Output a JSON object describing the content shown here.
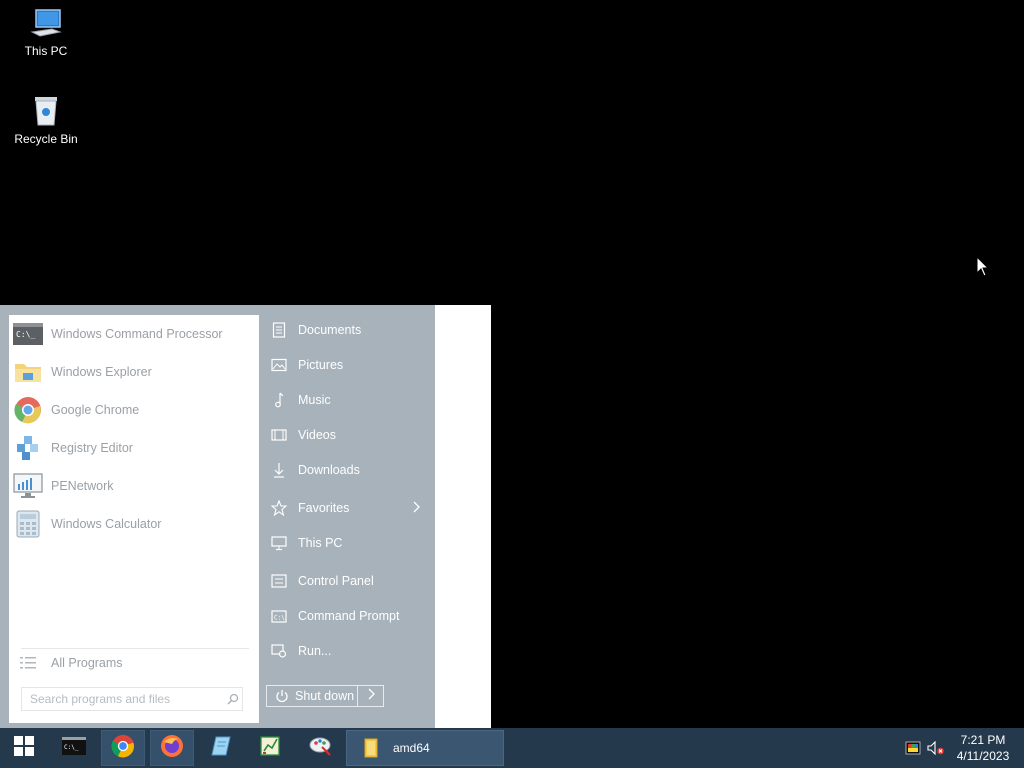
{
  "desktop": {
    "icons": [
      {
        "label": "This PC",
        "icon": "computer-icon"
      },
      {
        "label": "Recycle Bin",
        "icon": "recycle-bin-icon"
      }
    ]
  },
  "start_menu": {
    "programs": [
      {
        "label": "Windows Command Processor",
        "icon": "cmd-icon"
      },
      {
        "label": "Windows Explorer",
        "icon": "folder-icon"
      },
      {
        "label": "Google Chrome",
        "icon": "chrome-icon"
      },
      {
        "label": "Registry Editor",
        "icon": "registry-icon"
      },
      {
        "label": "PENetwork",
        "icon": "network-icon"
      },
      {
        "label": "Windows Calculator",
        "icon": "calculator-icon"
      }
    ],
    "all_programs_label": "All Programs",
    "search_placeholder": "Search programs and files",
    "right_items": [
      {
        "label": "Documents",
        "icon": "documents-icon"
      },
      {
        "label": "Pictures",
        "icon": "pictures-icon"
      },
      {
        "label": "Music",
        "icon": "music-icon"
      },
      {
        "label": "Videos",
        "icon": "videos-icon"
      },
      {
        "label": "Downloads",
        "icon": "downloads-icon"
      },
      {
        "label": "Favorites",
        "icon": "star-icon"
      },
      {
        "label": "This PC",
        "icon": "computer-icon"
      },
      {
        "label": "Control Panel",
        "icon": "control-panel-icon"
      },
      {
        "label": "Command Prompt",
        "icon": "cmd-icon"
      },
      {
        "label": "Run...",
        "icon": "run-icon"
      }
    ],
    "shutdown_label": "Shut down"
  },
  "taskbar": {
    "pinned": [
      {
        "icon": "cmd-icon"
      },
      {
        "icon": "chrome-icon"
      },
      {
        "icon": "firefox-icon"
      },
      {
        "icon": "notepad-icon"
      },
      {
        "icon": "spreadsheet-icon"
      },
      {
        "icon": "paint-icon"
      }
    ],
    "window_label": "amd64",
    "clock_time": "7:21 PM",
    "clock_date": "4/11/2023"
  },
  "colors": {
    "desktop_bg": "#000000",
    "taskbar_bg": "#243a4c",
    "start_menu_frame": "#a8b2ba"
  }
}
